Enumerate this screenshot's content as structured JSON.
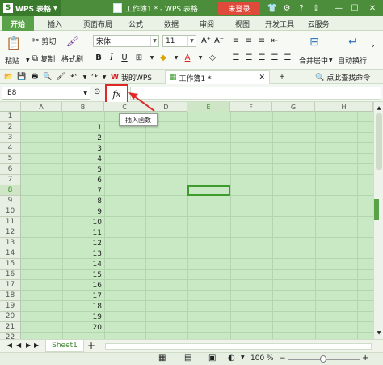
{
  "titlebar": {
    "app_menu_label": "WPS 表格",
    "doc_title": "工作簿1 * - WPS 表格",
    "login_label": "未登录"
  },
  "menu": {
    "tabs": [
      "开始",
      "插入",
      "页面布局",
      "公式",
      "数据",
      "审阅",
      "视图",
      "开发工具",
      "云服务"
    ]
  },
  "ribbon": {
    "paste_label": "粘贴",
    "cut_label": "剪切",
    "copy_label": "复制",
    "format_painter_label": "格式刷",
    "font_name": "宋体",
    "font_size": "11",
    "bold": "B",
    "italic": "I",
    "underline": "U",
    "merge_label": "合并居中",
    "wrap_label": "自动换行"
  },
  "doctabs": {
    "mywps_label": "我的WPS",
    "workbook_label": "工作簿1 *",
    "search_label": "点此查找命令"
  },
  "formula": {
    "cell_ref": "E8",
    "fx_label": "fx",
    "tooltip": "插入函数"
  },
  "grid": {
    "columns": [
      "A",
      "B",
      "C",
      "D",
      "E",
      "F",
      "G",
      "H"
    ],
    "rows": [
      "1",
      "2",
      "3",
      "4",
      "5",
      "6",
      "7",
      "8",
      "9",
      "10",
      "11",
      "12",
      "13",
      "14",
      "15",
      "16",
      "17",
      "18",
      "19",
      "20",
      "21",
      "22"
    ],
    "b_values": [
      "",
      "1",
      "2",
      "3",
      "4",
      "5",
      "6",
      "7",
      "8",
      "9",
      "10",
      "11",
      "12",
      "13",
      "14",
      "15",
      "16",
      "17",
      "18",
      "19",
      "20",
      ""
    ]
  },
  "sheets": {
    "tabs": [
      "Sheet1"
    ],
    "add": "+"
  },
  "status": {
    "zoom": "100 %"
  },
  "colors": {
    "accent": "#5aa24a",
    "grid_bg": "#c9e9c4",
    "highlight": "#e02828"
  }
}
